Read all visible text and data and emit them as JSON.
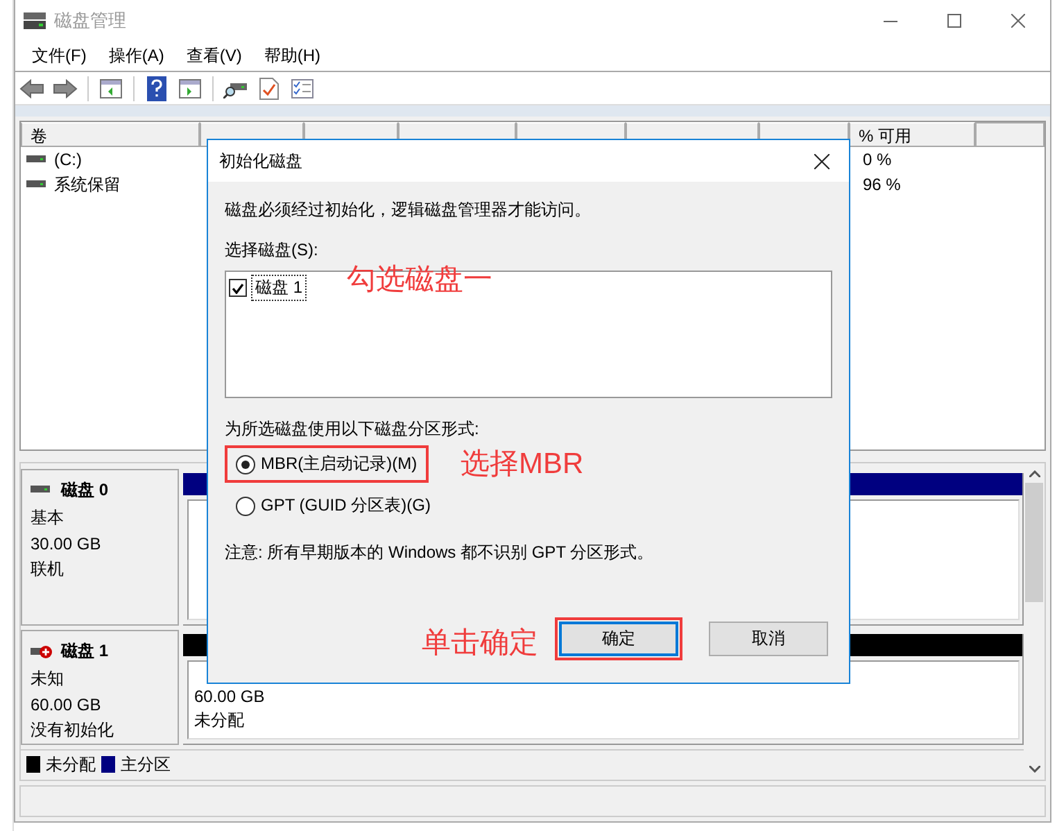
{
  "window": {
    "title": "磁盘管理"
  },
  "menu": [
    "文件(F)",
    "操作(A)",
    "查看(V)",
    "帮助(H)"
  ],
  "volume_table": {
    "columns": [
      "卷",
      "% 可用"
    ],
    "rows": [
      {
        "volume": "(C:)",
        "percent_free": "0 %"
      },
      {
        "volume": "系统保留",
        "percent_free": "96 %"
      }
    ]
  },
  "disks": [
    {
      "name": "磁盘 0",
      "kind": "online",
      "type": "基本",
      "size": "30.00 GB",
      "status": "联机",
      "partition": {
        "color": "#000080"
      }
    },
    {
      "name": "磁盘 1",
      "kind": "uninitialized",
      "type": "未知",
      "size": "60.00 GB",
      "status": "没有初始化",
      "partition": {
        "color": "#000000",
        "lines": [
          "60.00 GB",
          "未分配"
        ]
      }
    }
  ],
  "legend": [
    {
      "label": "未分配",
      "color": "#000000"
    },
    {
      "label": "主分区",
      "color": "#000080"
    }
  ],
  "dialog": {
    "title": "初始化磁盘",
    "message": "磁盘必须经过初始化，逻辑磁盘管理器才能访问。",
    "select_label": "选择磁盘(S):",
    "disks": [
      {
        "label": "磁盘 1",
        "checked": true
      }
    ],
    "style_label": "为所选磁盘使用以下磁盘分区形式:",
    "options": [
      {
        "label": "MBR(主启动记录)(M)",
        "selected": true,
        "highlighted": true
      },
      {
        "label": "GPT (GUID 分区表)(G)",
        "selected": false,
        "highlighted": false
      }
    ],
    "note": "注意: 所有早期版本的 Windows 都不识别 GPT 分区形式。",
    "buttons": [
      {
        "label": "确定",
        "default": true,
        "highlighted": true
      },
      {
        "label": "取消",
        "default": false,
        "highlighted": false
      }
    ]
  },
  "annotations": [
    "勾选磁盘一",
    "选择MBR",
    "单击确定"
  ]
}
